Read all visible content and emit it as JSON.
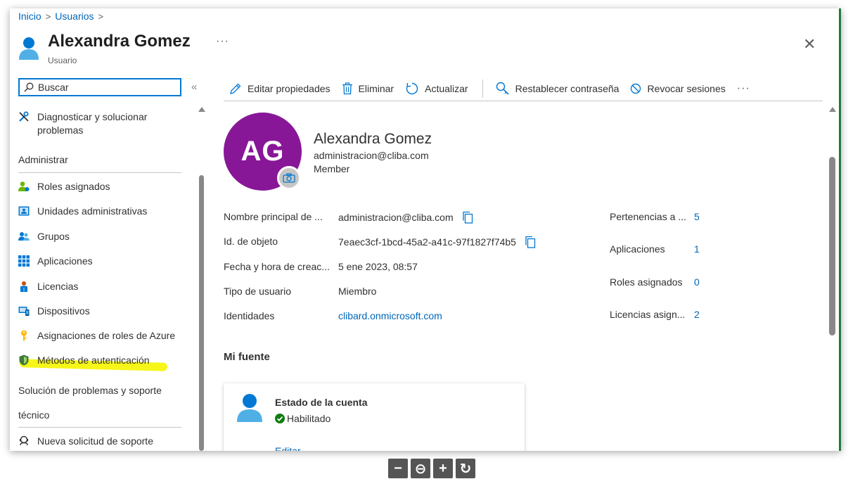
{
  "breadcrumb": {
    "home": "Inicio",
    "users": "Usuarios",
    "sep": ">"
  },
  "header": {
    "title": "Alexandra Gomez",
    "subtitle": "Usuario",
    "more": "···",
    "close": "✕"
  },
  "nav": {
    "search_label": "Buscar",
    "collapse": "«",
    "items": [
      {
        "label": "Diagnosticar y solucionar problemas",
        "icon": "wrench-icon"
      },
      {
        "label": "Roles asignados",
        "icon": "user-role-icon"
      },
      {
        "label": "Unidades administrativas",
        "icon": "admin-unit-icon"
      },
      {
        "label": "Grupos",
        "icon": "groups-icon"
      },
      {
        "label": "Aplicaciones",
        "icon": "apps-grid-icon"
      },
      {
        "label": "Licencias",
        "icon": "license-icon"
      },
      {
        "label": "Dispositivos",
        "icon": "device-icon"
      },
      {
        "label": "Asignaciones de roles de Azure",
        "icon": "key-icon"
      },
      {
        "label": "Métodos de autenticación",
        "icon": "shield-icon"
      },
      {
        "label": "Nueva solicitud de soporte",
        "icon": "support-icon"
      }
    ],
    "section_admin": "Administrar",
    "section_support_1": "Solución de problemas y soporte",
    "section_support_2": "técnico"
  },
  "toolbar": {
    "edit": "Editar propiedades",
    "delete": "Eliminar",
    "refresh": "Actualizar",
    "reset_password": "Restablecer contraseña",
    "revoke": "Revocar sesiones",
    "more": "···"
  },
  "profile": {
    "initials": "AG",
    "name": "Alexandra Gomez",
    "email": "administracion@cliba.com",
    "type": "Member"
  },
  "properties": {
    "upn_label": "Nombre principal de ...",
    "upn_value": "administracion@cliba.com",
    "objectid_label": "Id. de objeto",
    "objectid_value": "7eaec3cf-1bcd-45a2-a41c-97f1827f74b5",
    "created_label": "Fecha y hora de creac...",
    "created_value": "5 ene 2023, 08:57",
    "usertype_label": "Tipo de usuario",
    "usertype_value": "Miembro",
    "identities_label": "Identidades",
    "identities_value": "clibard.onmicrosoft.com"
  },
  "stats": [
    {
      "label": "Pertenencias a ...",
      "value": "5"
    },
    {
      "label": "Aplicaciones",
      "value": "1"
    },
    {
      "label": "Roles asignados",
      "value": "0"
    },
    {
      "label": "Licencias asign...",
      "value": "2"
    }
  ],
  "feed": {
    "title": "Mi fuente",
    "card_title": "Estado de la cuenta",
    "card_status": "Habilitado",
    "card_link": "Editar"
  },
  "zoom": {
    "out": "−",
    "reset": "⊖",
    "in": "+",
    "refresh": "↻"
  },
  "colors": {
    "accent": "#0078d4",
    "link": "#0066b8",
    "avatar": "#881798",
    "highlight": "#f5f500"
  }
}
